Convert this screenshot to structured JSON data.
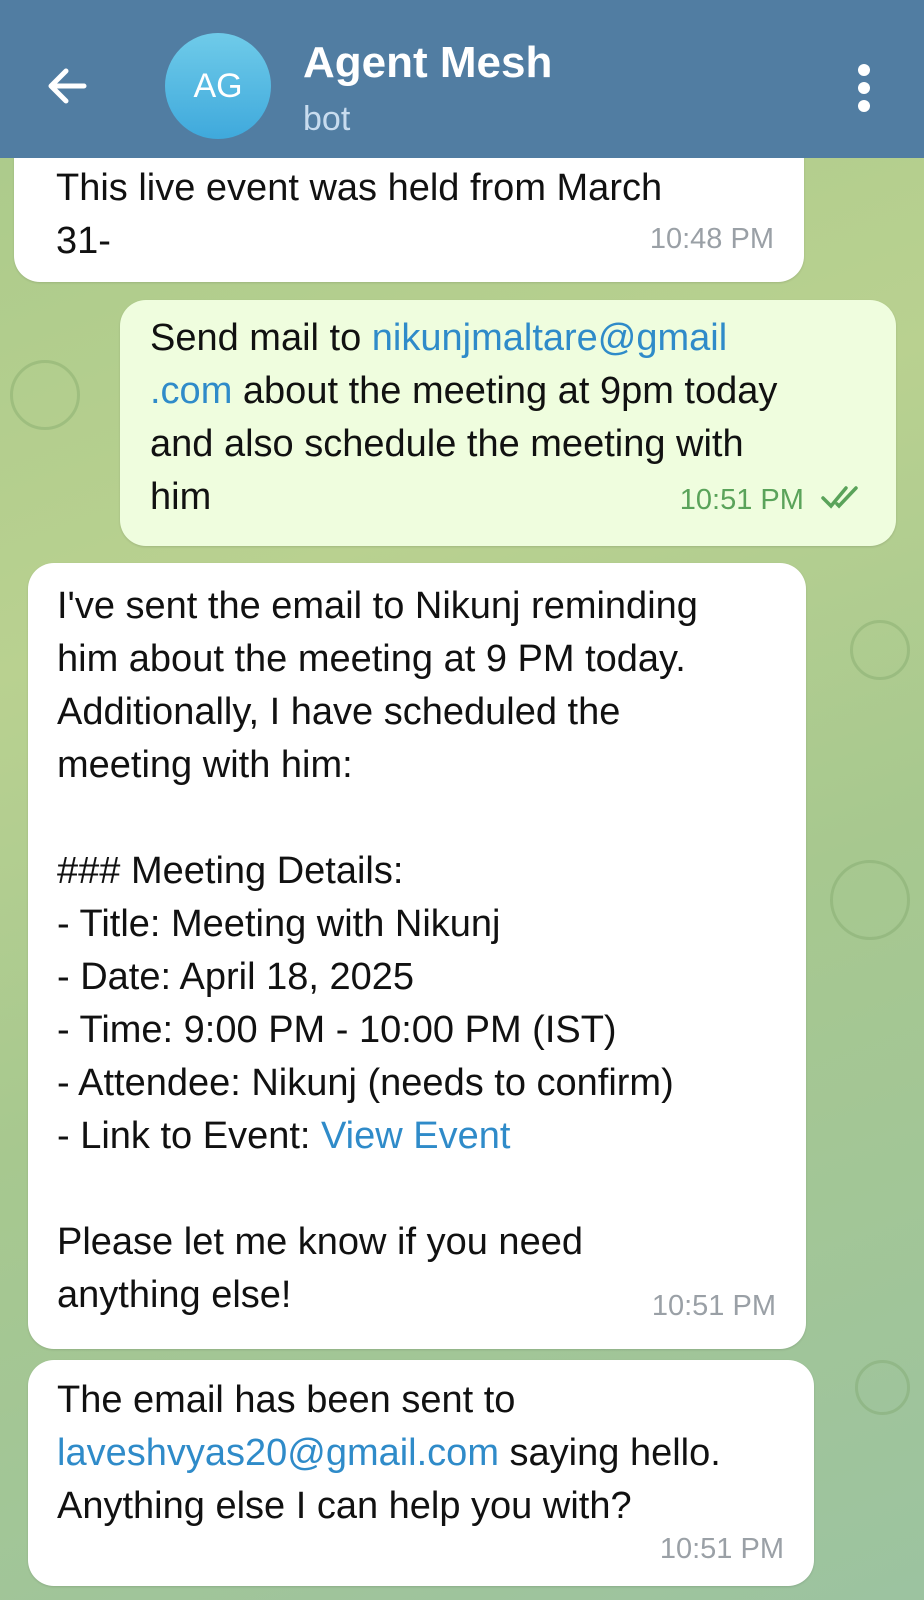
{
  "header": {
    "avatar_initials": "AG",
    "title": "Agent Mesh",
    "subtitle": "bot"
  },
  "messages": [
    {
      "direction": "incoming",
      "text_line1": "This live event was held from March",
      "text_line2": "31-",
      "time": "10:48 PM"
    },
    {
      "direction": "outgoing",
      "prefix": "Send mail to ",
      "email_part1": "nikunjmaltare@gmail",
      "email_part2": ".com",
      "suffix_line2": " about the meeting at 9pm today",
      "line3": "and also schedule the meeting with",
      "line4": "him",
      "time": "10:51 PM",
      "status": "read"
    },
    {
      "direction": "incoming",
      "lines": [
        "I've sent the email to Nikunj reminding",
        "him about the meeting at 9 PM today.",
        "Additionally, I have scheduled the",
        "meeting with him:",
        "",
        "### Meeting Details:",
        "- Title: Meeting with Nikunj",
        "- Date: April 18, 2025",
        "- Time: 9:00 PM - 10:00 PM (IST)",
        "- Attendee: Nikunj (needs to confirm)"
      ],
      "link_prefix": "- Link to Event: ",
      "link_text": "View Event",
      "closing_line1": "Please let me know if you need",
      "closing_line2": "anything else!",
      "time": "10:51 PM"
    },
    {
      "direction": "incoming",
      "line1": "The email has been sent to",
      "email": "laveshvyas20@gmail.com",
      "line2_suffix": " saying hello.",
      "line3": "Anything else I can help you with?",
      "time": "10:51 PM"
    }
  ],
  "colors": {
    "header": "#517da2",
    "incoming_bubble": "#ffffff",
    "outgoing_bubble": "#effdde",
    "link": "#2f8bc9"
  }
}
